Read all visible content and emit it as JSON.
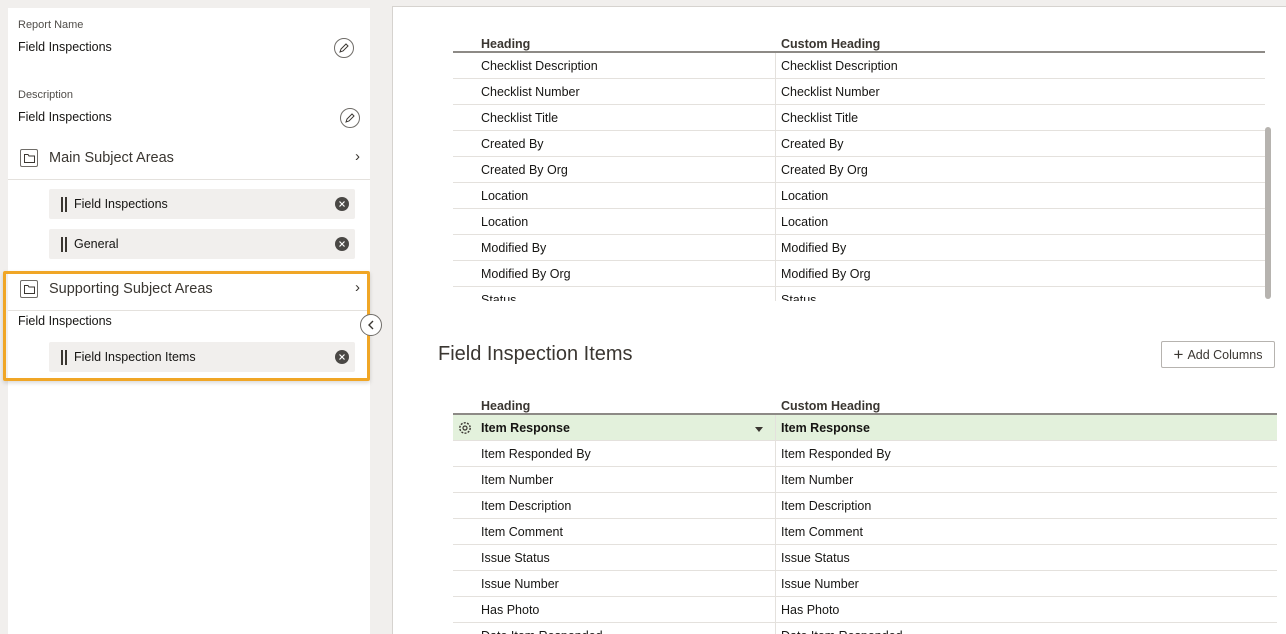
{
  "report": {
    "name_label": "Report Name",
    "name_value": "Field Inspections",
    "description_label": "Description",
    "description_value": "Field Inspections"
  },
  "main_subject_areas": {
    "title": "Main Subject Areas",
    "items": [
      "Field Inspections",
      "General"
    ]
  },
  "supporting_subject_areas": {
    "title": "Supporting Subject Areas",
    "group_label": "Field Inspections",
    "items": [
      "Field Inspection Items"
    ]
  },
  "table1": {
    "col_heading": "Heading",
    "col_custom": "Custom Heading",
    "rows": [
      [
        "Checklist Description",
        "Checklist Description"
      ],
      [
        "Checklist Number",
        "Checklist Number"
      ],
      [
        "Checklist Title",
        "Checklist Title"
      ],
      [
        "Created By",
        "Created By"
      ],
      [
        "Created By Org",
        "Created By Org"
      ],
      [
        "Location",
        "Location"
      ],
      [
        "Location",
        "Location"
      ],
      [
        "Modified By",
        "Modified By"
      ],
      [
        "Modified By Org",
        "Modified By Org"
      ],
      [
        "Status",
        "Status"
      ]
    ]
  },
  "section2": {
    "title": "Field Inspection Items",
    "add_button": "Add Columns"
  },
  "table2": {
    "col_heading": "Heading",
    "col_custom": "Custom Heading",
    "selected_row_index": 0,
    "rows": [
      [
        "Item Response",
        "Item Response"
      ],
      [
        "Item Responded By",
        "Item Responded By"
      ],
      [
        "Item Number",
        "Item Number"
      ],
      [
        "Item Description",
        "Item Description"
      ],
      [
        "Item Comment",
        "Item Comment"
      ],
      [
        "Issue Status",
        "Issue Status"
      ],
      [
        "Issue Number",
        "Issue Number"
      ],
      [
        "Has Photo",
        "Has Photo"
      ],
      [
        "Date Item Responded",
        "Date Item Responded"
      ]
    ]
  },
  "colors": {
    "highlight_border": "#f0a626",
    "selected_row_bg": "#e3f1dc",
    "chip_bg": "#f1efed"
  }
}
